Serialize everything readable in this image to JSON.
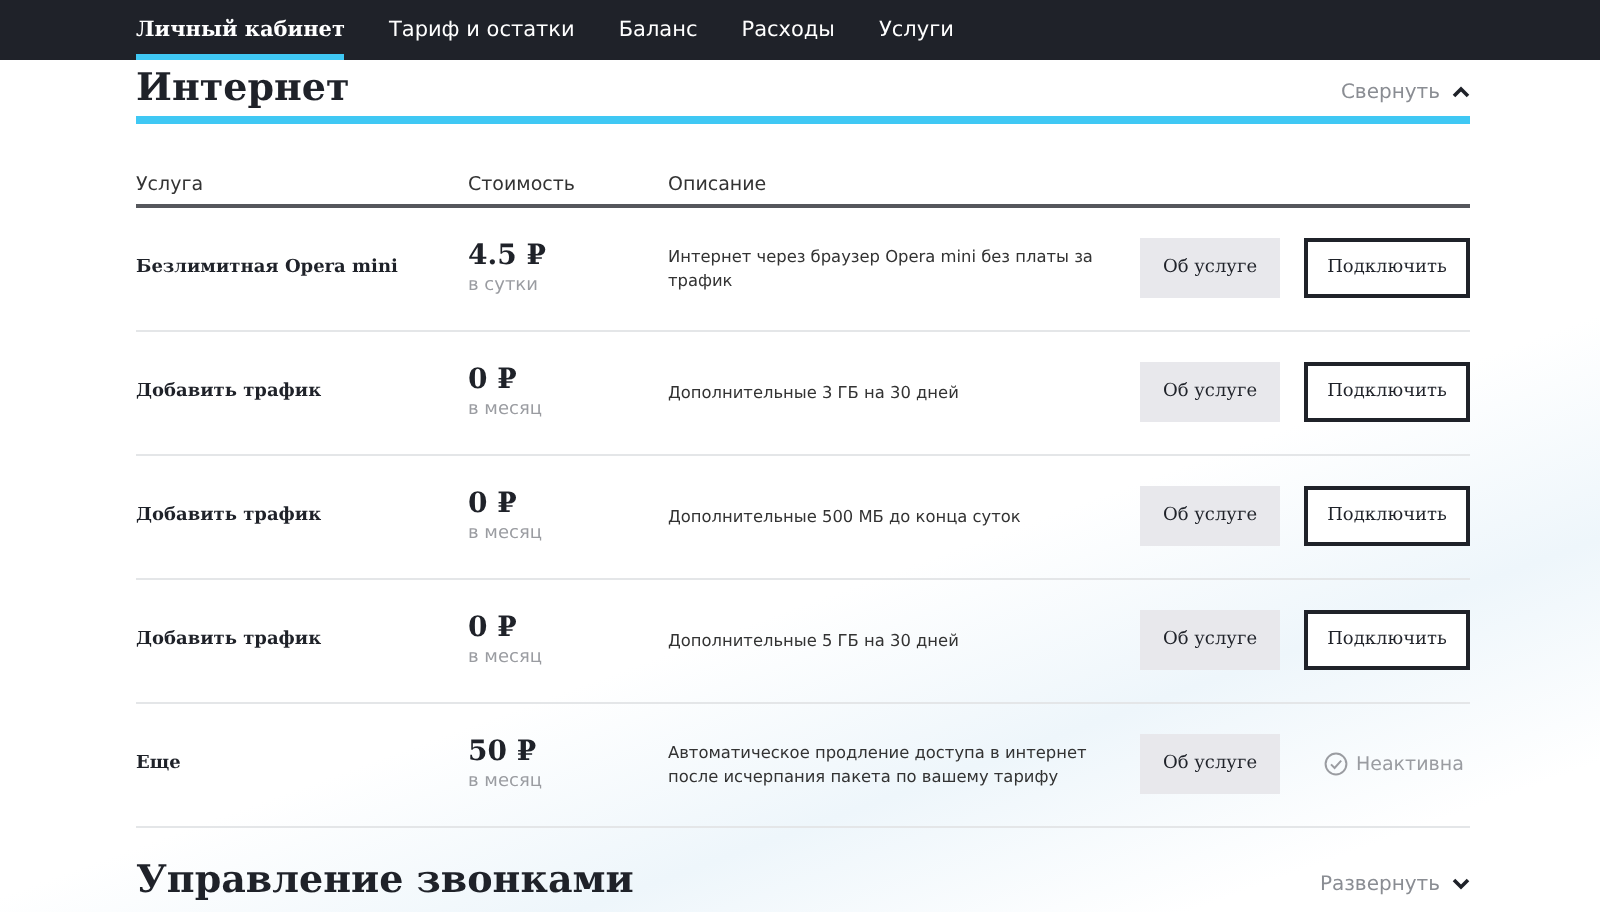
{
  "nav": [
    {
      "label": "Личный кабинет",
      "selected": true
    },
    {
      "label": "Тариф и остатки",
      "selected": false
    },
    {
      "label": "Баланс",
      "selected": false
    },
    {
      "label": "Расходы",
      "selected": false
    },
    {
      "label": "Услуги",
      "selected": false
    }
  ],
  "sections": [
    {
      "title": "Интернет",
      "toggle": "Свернуть",
      "expanded": true,
      "columns": [
        "Услуга",
        "Стоимость",
        "Описание"
      ],
      "rows": [
        {
          "name": "Безлимитная Opera mini",
          "price": "4.5 ₽",
          "period": "в сутки",
          "description": "Интернет через браузер Opera mini без платы за трафик",
          "info_button": "Об услуге",
          "kind": "connect",
          "action": "Подключить"
        },
        {
          "name": "Добавить трафик",
          "price": "0 ₽",
          "period": "в месяц",
          "description": "Дополнительные 3 ГБ на 30 дней",
          "info_button": "Об услуге",
          "kind": "connect",
          "action": "Подключить"
        },
        {
          "name": "Добавить трафик",
          "price": "0 ₽",
          "period": "в месяц",
          "description": "Дополнительные 500 МБ до конца суток",
          "info_button": "Об услуге",
          "kind": "connect",
          "action": "Подключить"
        },
        {
          "name": "Добавить трафик",
          "price": "0 ₽",
          "period": "в месяц",
          "description": "Дополнительные 5 ГБ на 30 дней",
          "info_button": "Об услуге",
          "kind": "connect",
          "action": "Подключить"
        },
        {
          "name": "Еще",
          "price": "50 ₽",
          "period": "в месяц",
          "description": "Автоматическое продление доступа в интернет после исчерпания пакета по вашему тарифу",
          "info_button": "Об услуге",
          "kind": "status",
          "action": "Неактивна"
        }
      ]
    },
    {
      "title": "Управление звонками",
      "toggle": "Развернуть",
      "expanded": false
    }
  ]
}
